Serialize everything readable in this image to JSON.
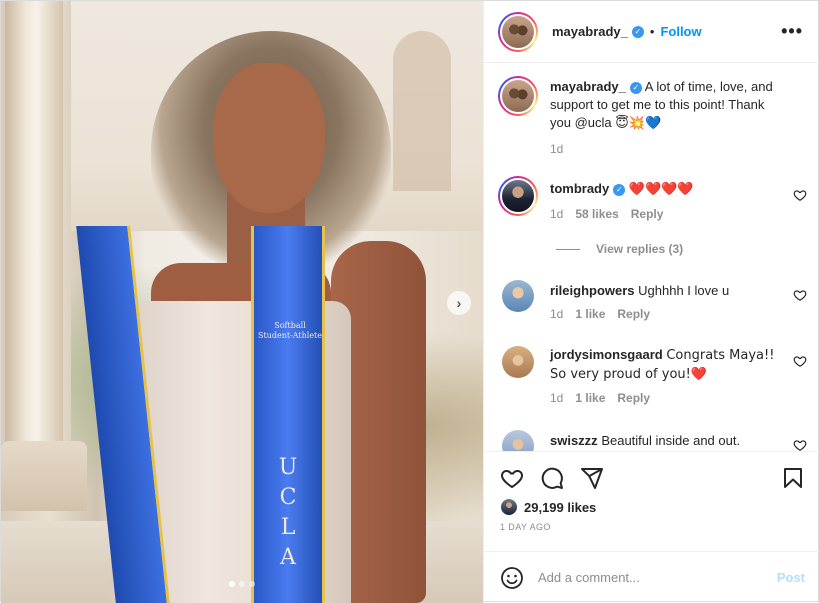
{
  "post": {
    "photo": {
      "sash_text_line1": "Softball",
      "sash_text_line2": "Student-Athlete",
      "sash_text_vertical": "UCLA",
      "carousel_index": 1,
      "carousel_count": 3
    },
    "header": {
      "username": "mayabrady_",
      "verified": true,
      "separator": "•",
      "follow_label": "Follow",
      "more_icon": "more-horizontal-icon"
    },
    "caption": {
      "username": "mayabrady_",
      "text": "A lot of time, love, and support to get me to this point! Thank you @ucla",
      "emojis": "😇💥💙",
      "time": "1d"
    },
    "comments": [
      {
        "username": "tombrady",
        "verified": true,
        "text": "❤️❤️❤️❤️",
        "time": "1d",
        "likes": "58 likes",
        "reply_label": "Reply"
      },
      {
        "username": "rileighpowers",
        "text": "Ughhhh I love u",
        "time": "1d",
        "likes": "1 like",
        "reply_label": "Reply"
      },
      {
        "username": "jordysimonsgaard",
        "text": "Congrats Maya!! So very proud of you!❤️",
        "time": "1d",
        "likes": "1 like",
        "reply_label": "Reply"
      },
      {
        "username": "swiszzz",
        "text": "Beautiful inside and out."
      }
    ],
    "view_replies_label": "View replies (3)",
    "actions": {
      "like_icon": "heart-icon",
      "comment_icon": "comment-icon",
      "share_icon": "share-icon",
      "save_icon": "bookmark-icon"
    },
    "likes_count": "29,199 likes",
    "time_ago": "1 DAY AGO",
    "add_comment": {
      "placeholder": "Add a comment...",
      "post_label": "Post"
    }
  },
  "colors": {
    "link_blue": "#0095f6",
    "muted": "#8e8e8e",
    "post_disabled": "#b2dffc",
    "heart_red": "#ed4956"
  }
}
